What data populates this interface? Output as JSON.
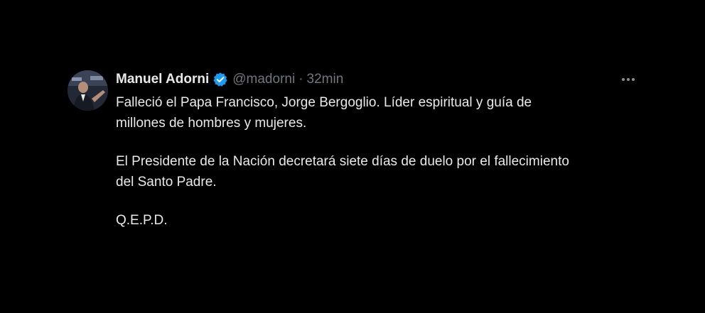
{
  "tweet": {
    "author": {
      "display_name": "Manuel Adorni",
      "handle": "@madorni",
      "verified": true,
      "avatar_icon": "user-avatar"
    },
    "separator": "·",
    "timestamp": "32min",
    "more_icon": "more-dots-icon",
    "paragraphs": [
      {
        "line1": "Falleció el Papa Francisco, Jorge Bergoglio. Líder espiritual y guía de",
        "line2": "millones de hombres y mujeres."
      },
      {
        "line1": "El Presidente de la Nación decretará siete días de duelo por el fallecimiento",
        "line2": "del Santo Padre."
      },
      {
        "line1": "Q.E.P.D.",
        "line2": ""
      }
    ]
  },
  "colors": {
    "background": "#000000",
    "primary_text": "#e7e9ea",
    "secondary_text": "#71767b",
    "verified_blue": "#1d9bf0"
  }
}
